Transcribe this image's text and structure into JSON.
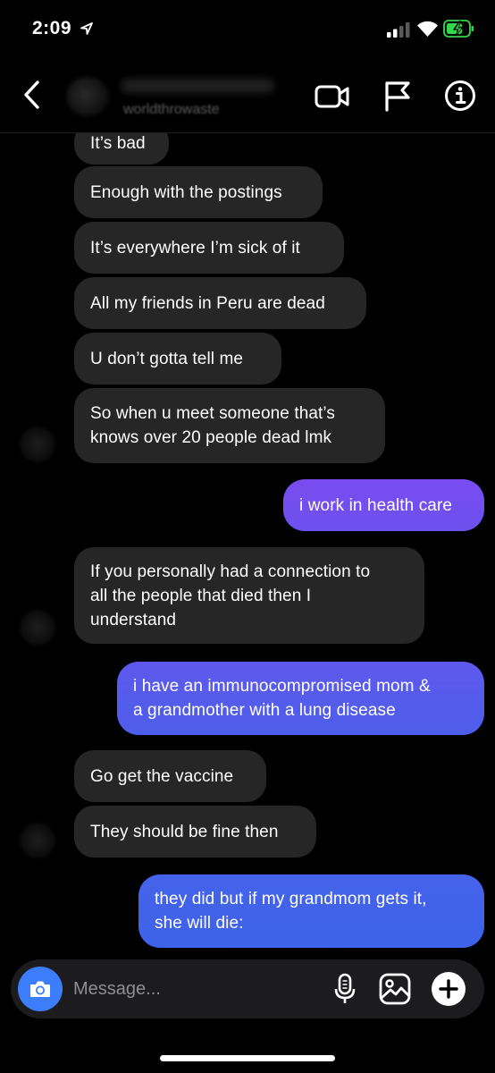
{
  "status_bar": {
    "time": "2:09"
  },
  "header": {
    "username": "worldthrowaste",
    "icons": [
      "chevron-left-icon",
      "video-camera-icon",
      "flag-icon",
      "info-icon"
    ]
  },
  "messages": [
    {
      "from": "them",
      "text": "It’s bad"
    },
    {
      "from": "them",
      "text": "Enough with the postings"
    },
    {
      "from": "them",
      "text": "It’s everywhere I’m sick of it"
    },
    {
      "from": "them",
      "text": "All my friends in Peru are dead"
    },
    {
      "from": "them",
      "text": "U don’t gotta tell me"
    },
    {
      "from": "them",
      "lines": [
        "So when u meet someone that’s",
        "knows over 20 people dead lmk"
      ]
    },
    {
      "from": "me",
      "text": "i work in health care"
    },
    {
      "from": "them",
      "lines": [
        "If you personally had a connection to",
        "all the people that died then I",
        "understand"
      ]
    },
    {
      "from": "me",
      "lines": [
        "i have an immunocompromised mom &",
        "a grandmother with a lung disease"
      ]
    },
    {
      "from": "them",
      "text": "Go get the vaccine"
    },
    {
      "from": "them",
      "text": "They should be fine then"
    },
    {
      "from": "me",
      "lines": [
        "they did but if my grandmom gets it,",
        "she will die:"
      ]
    }
  ],
  "composer": {
    "placeholder": "Message..."
  },
  "colors": {
    "background": "#000000",
    "incoming_bubble": "#262626",
    "outgoing_gradient_top": "#7a4cf0",
    "outgoing_gradient_bottom": "#3d63e8",
    "camera_button": "#3b7dfa"
  }
}
